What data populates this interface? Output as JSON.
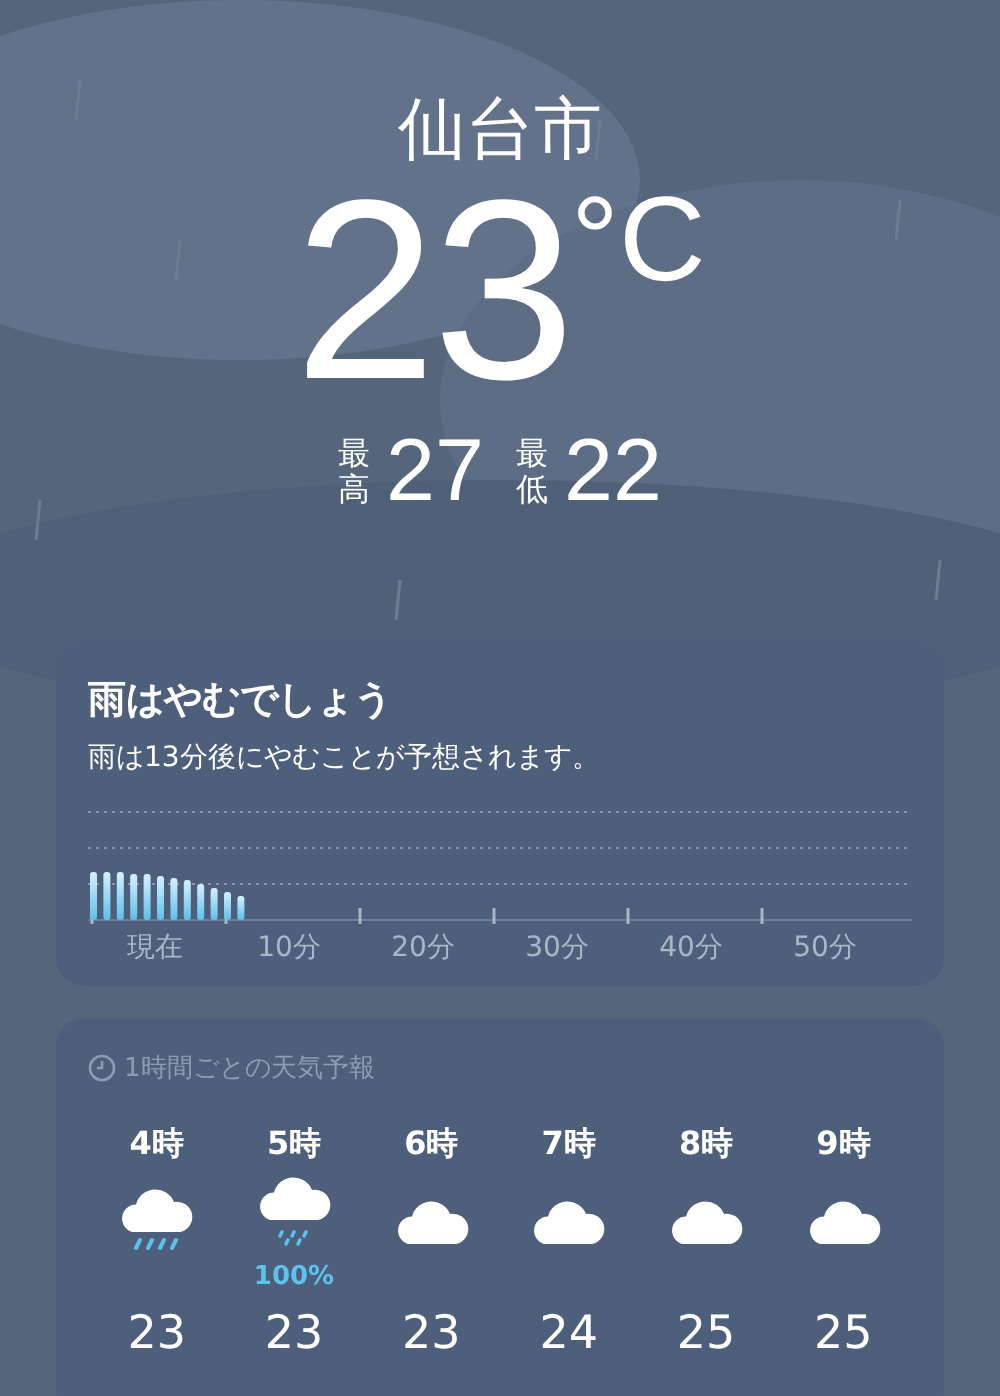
{
  "location": {
    "city": "仙台市",
    "temperature": "23",
    "unit": "°C",
    "high_label": "最高",
    "high": "27",
    "low_label": "最低",
    "low": "22"
  },
  "rain_card": {
    "title": "雨はやむでしょう",
    "message": "雨は13分後にやむことが予想されます。",
    "axis_labels": [
      "現在",
      "10分",
      "20分",
      "30分",
      "40分",
      "50分"
    ]
  },
  "hourly_card": {
    "title": "1時間ごとの天気予報",
    "hours": [
      {
        "time": "4時",
        "kind": "rain",
        "temperature": "23"
      },
      {
        "time": "5時",
        "kind": "rain-light",
        "precipitation": "100%",
        "temperature": "23"
      },
      {
        "time": "6時",
        "kind": "cloud",
        "temperature": "23"
      },
      {
        "time": "7時",
        "kind": "cloud",
        "temperature": "24"
      },
      {
        "time": "8時",
        "kind": "cloud",
        "temperature": "25"
      },
      {
        "time": "9時",
        "kind": "cloud",
        "temperature": "25"
      }
    ]
  }
}
